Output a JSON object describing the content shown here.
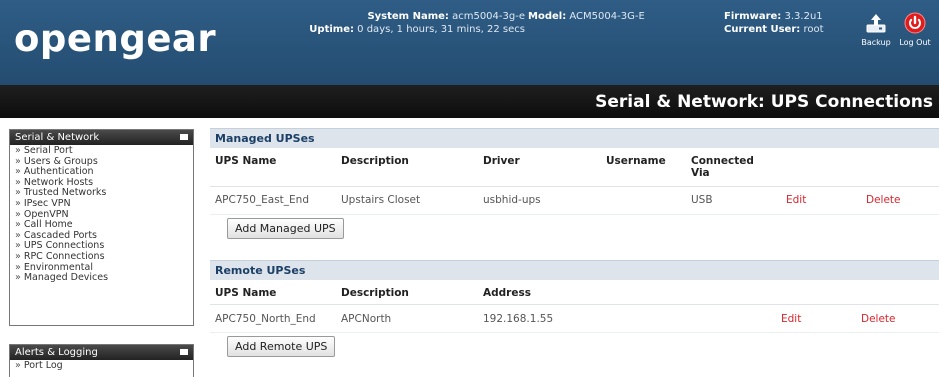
{
  "header": {
    "logo": "opengear",
    "system_name_label": "System Name:",
    "system_name": "acm5004-3g-e",
    "model_label": "Model:",
    "model": "ACM5004-3G-E",
    "uptime_label": "Uptime:",
    "uptime": "0 days, 1 hours, 31 mins, 22 secs",
    "firmware_label": "Firmware:",
    "firmware": "3.3.2u1",
    "current_user_label": "Current User:",
    "current_user": "root",
    "backup_label": "Backup",
    "logout_label": "Log Out"
  },
  "page_title": "Serial & Network: UPS Connections",
  "sidebar": {
    "sections": [
      {
        "title": "Serial & Network",
        "items": [
          "Serial Port",
          "Users & Groups",
          "Authentication",
          "Network Hosts",
          "Trusted Networks",
          "IPsec VPN",
          "OpenVPN",
          "Call Home",
          "Cascaded Ports",
          "UPS Connections",
          "RPC Connections",
          "Environmental",
          "Managed Devices"
        ]
      },
      {
        "title": "Alerts & Logging",
        "items": [
          "Port Log"
        ]
      }
    ]
  },
  "managed": {
    "title": "Managed UPSes",
    "columns": [
      "UPS Name",
      "Description",
      "Driver",
      "Username",
      "Connected Via"
    ],
    "rows": [
      {
        "name": "APC750_East_End",
        "description": "Upstairs Closet",
        "driver": "usbhid-ups",
        "username": "",
        "via": "USB",
        "edit": "Edit",
        "delete": "Delete"
      }
    ],
    "add_button": "Add Managed UPS"
  },
  "remote": {
    "title": "Remote UPSes",
    "columns": [
      "UPS Name",
      "Description",
      "Address"
    ],
    "rows": [
      {
        "name": "APC750_North_End",
        "description": "APCNorth",
        "address": "192.168.1.55",
        "edit": "Edit",
        "delete": "Delete"
      }
    ],
    "add_button": "Add Remote UPS"
  },
  "colors": {
    "header_bg": "#2b5880",
    "titlebar_bg": "#141414",
    "section_bg": "#dde4ec",
    "section_text": "#1c3f66",
    "action_red": "#d8262c"
  },
  "icons": {
    "backup": "backup-icon",
    "logout": "power-icon",
    "collapse": "collapse-icon"
  }
}
